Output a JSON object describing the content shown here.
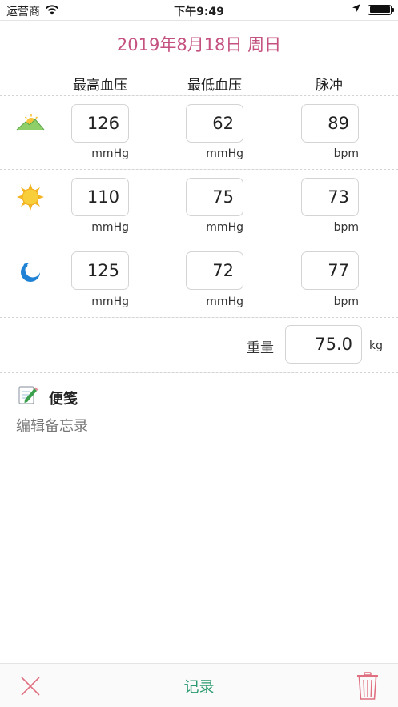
{
  "status_bar": {
    "carrier": "运营商",
    "time": "下午9:49",
    "battery_level": 1.0
  },
  "header": {
    "date": "2019年8月18日 周日"
  },
  "columns": {
    "systolic": "最高血压",
    "diastolic": "最低血压",
    "pulse": "脉冲"
  },
  "readings": [
    {
      "period_icon": "sunrise-mountain-icon",
      "systolic": "126",
      "diastolic": "62",
      "pulse": "89",
      "pressure_unit": "mmHg",
      "pulse_unit": "bpm"
    },
    {
      "period_icon": "sun-icon",
      "systolic": "110",
      "diastolic": "75",
      "pulse": "73",
      "pressure_unit": "mmHg",
      "pulse_unit": "bpm"
    },
    {
      "period_icon": "moon-icon",
      "systolic": "125",
      "diastolic": "72",
      "pulse": "77",
      "pressure_unit": "mmHg",
      "pulse_unit": "bpm"
    }
  ],
  "weight": {
    "label": "重量",
    "value": "75.0",
    "unit": "kg"
  },
  "notes": {
    "title": "便笺",
    "placeholder": "编辑备忘录"
  },
  "toolbar": {
    "record_label": "记录"
  },
  "colors": {
    "date_accent": "#c4517f",
    "record_green": "#2a9a6e",
    "delete_red": "#e07080"
  }
}
